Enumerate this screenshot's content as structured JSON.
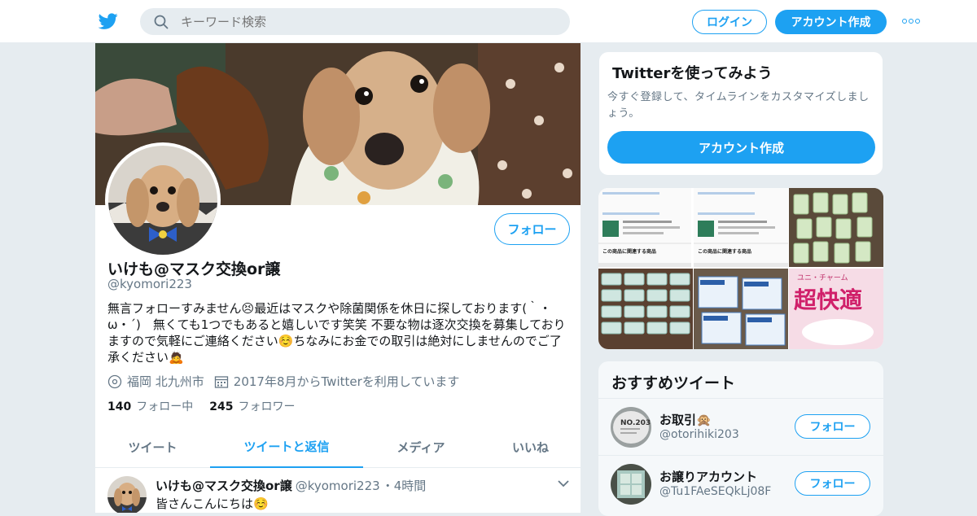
{
  "header": {
    "search_placeholder": "キーワード検索",
    "login_label": "ログイン",
    "signup_label": "アカウント作成",
    "brand_color": "#1da1f2"
  },
  "profile": {
    "follow_label": "フォロー",
    "name": "いけも@マスク交換or譲",
    "handle": "@kyomori223",
    "bio": "無言フォローすみません😣最近はマスクや除菌関係を休日に探しております(｀・ω・´)　無くても1つでもあると嬉しいです笑笑 不要な物は逐次交換を募集しておりますので気軽にご連絡ください☺️ちなみにお金での取引は絶対にしませんのでご了承ください🙇",
    "location": "福岡 北九州市",
    "joined": "2017年8月からTwitterを利用しています",
    "following_count": "140",
    "following_label": "フォロー中",
    "followers_count": "245",
    "followers_label": "フォロワー"
  },
  "tabs": [
    {
      "label": "ツイート"
    },
    {
      "label": "ツイートと返信"
    },
    {
      "label": "メディア"
    },
    {
      "label": "いいね"
    }
  ],
  "active_tab": "ツイートと返信",
  "tweet": {
    "name": "いけも@マスク交換or譲",
    "handle": "@kyomori223",
    "time": "・4時間",
    "text": "皆さんこんにちは☺️"
  },
  "signup_card": {
    "title": "Twitterを使ってみよう",
    "description": "今すぐ登録して、タイムラインをカスタマイズしましょう。",
    "button_label": "アカウント作成"
  },
  "recommendations": {
    "title": "おすすめツイート",
    "items": [
      {
        "name": "お取引🙊",
        "handle": "@otorihiki203",
        "follow_label": "フォロー"
      },
      {
        "name": "お譲りアカウント",
        "handle": "@Tu1FAeSEQkLj08F",
        "follow_label": "フォロー"
      }
    ]
  },
  "media_tiles": {
    "screenshot_heading": "この商品に関連する商品",
    "mask_brand": "ユニ・チャーム",
    "mask_product": "超快適"
  }
}
